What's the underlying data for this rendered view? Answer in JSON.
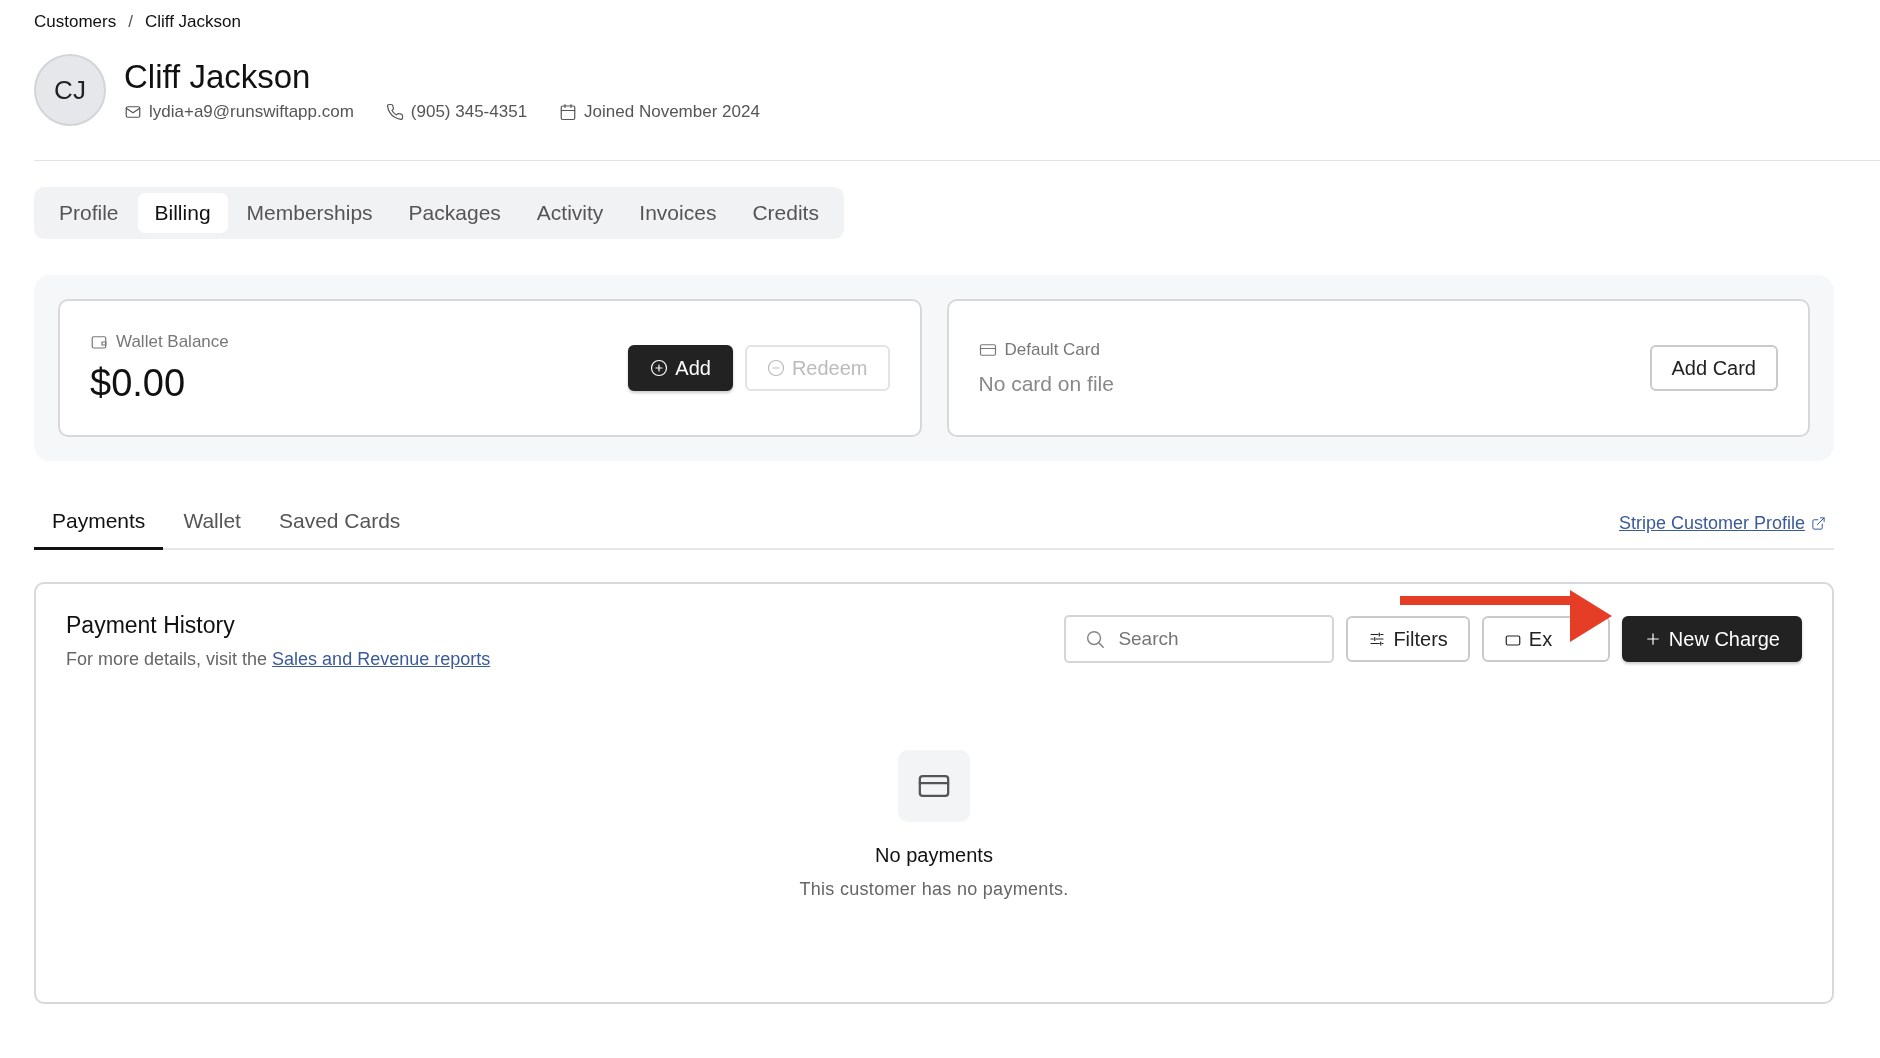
{
  "breadcrumb": [
    {
      "label": "Customers"
    },
    {
      "label": "Cliff Jackson"
    }
  ],
  "breadcrumb_separator": "/",
  "customer": {
    "initials": "CJ",
    "name": "Cliff Jackson",
    "email": "lydia+a9@runswiftapp.com",
    "phone": "(905) 345-4351",
    "joined": "Joined November 2024"
  },
  "tabs": [
    {
      "label": "Profile",
      "selected": false
    },
    {
      "label": "Billing",
      "selected": true
    },
    {
      "label": "Memberships",
      "selected": false
    },
    {
      "label": "Packages",
      "selected": false
    },
    {
      "label": "Activity",
      "selected": false
    },
    {
      "label": "Invoices",
      "selected": false
    },
    {
      "label": "Credits",
      "selected": false
    }
  ],
  "wallet": {
    "label": "Wallet Balance",
    "amount": "$0.00",
    "add_button": {
      "label": "Add",
      "disabled": false
    },
    "redeem_button": {
      "label": "Redeem",
      "disabled": true
    }
  },
  "default_card": {
    "label": "Default Card",
    "value": "No card on file",
    "button": "Add Card"
  },
  "subtabs": [
    {
      "label": "Payments",
      "selected": true
    },
    {
      "label": "Wallet",
      "selected": false
    },
    {
      "label": "Saved Cards",
      "selected": false
    }
  ],
  "stripe_link": "Stripe Customer Profile",
  "payment_history": {
    "title": "Payment History",
    "subtitle": "For more details, visit the ",
    "subtitle_link": "Sales and Revenue reports",
    "search": {
      "placeholder": "Search"
    },
    "filters_button": "Filters",
    "export_button": "Ex",
    "new_charge_button": "New Charge",
    "empty_title": "No payments",
    "empty_text": "This customer has no payments."
  }
}
